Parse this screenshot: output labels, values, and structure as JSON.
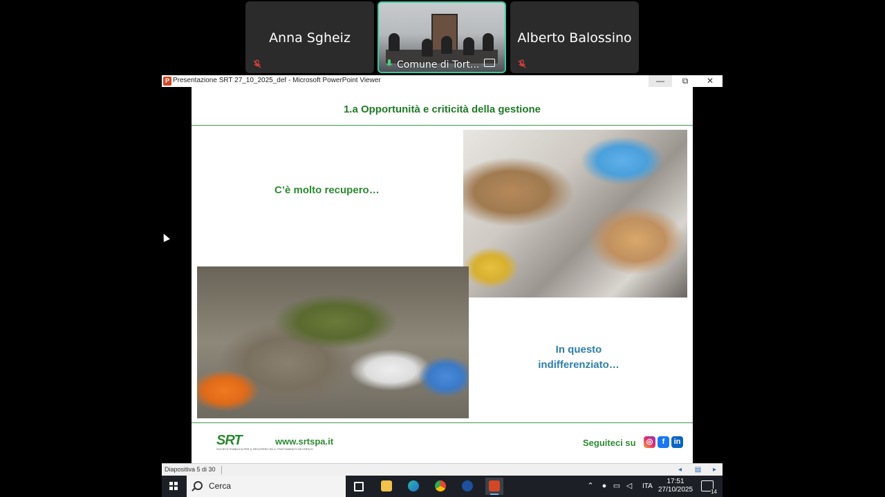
{
  "participants": [
    {
      "name": "Anna Sgheiz",
      "muted": true
    },
    {
      "name": "Comune di Tort...",
      "muted": false,
      "active": true
    },
    {
      "name": "Alberto Balossino",
      "muted": true
    }
  ],
  "window": {
    "title": "Presentazione SRT 27_10_2025_def - Microsoft PowerPoint Viewer",
    "minimize": "—",
    "restore": "⧉",
    "close": "✕"
  },
  "slide": {
    "title": "1.a Opportunità e criticità della gestione",
    "caption_top": "C’è molto recupero…",
    "caption_bottom": "In questo indifferenziato…",
    "logo_text": "SRT",
    "logo_sub": "SOCIETÀ PUBBLICA PER IL RECUPERO ED IL TRATTAMENTO DEI RIFIUTI",
    "website": "www.srtspa.it",
    "follow_text": "Seguiteci su",
    "social": [
      "instagram-icon",
      "facebook-icon",
      "linkedin-icon"
    ]
  },
  "statusbar": {
    "slide_counter": "Diapositiva 5 di 30"
  },
  "taskbar": {
    "search_placeholder": "Cerca",
    "language": "ITA",
    "time": "17:51",
    "date": "27/10/2025",
    "notifications": "14"
  },
  "colors": {
    "slide_green": "#1e7a25",
    "caption_blue": "#2d7fa8",
    "active_tile_border": "#38c8a0"
  }
}
